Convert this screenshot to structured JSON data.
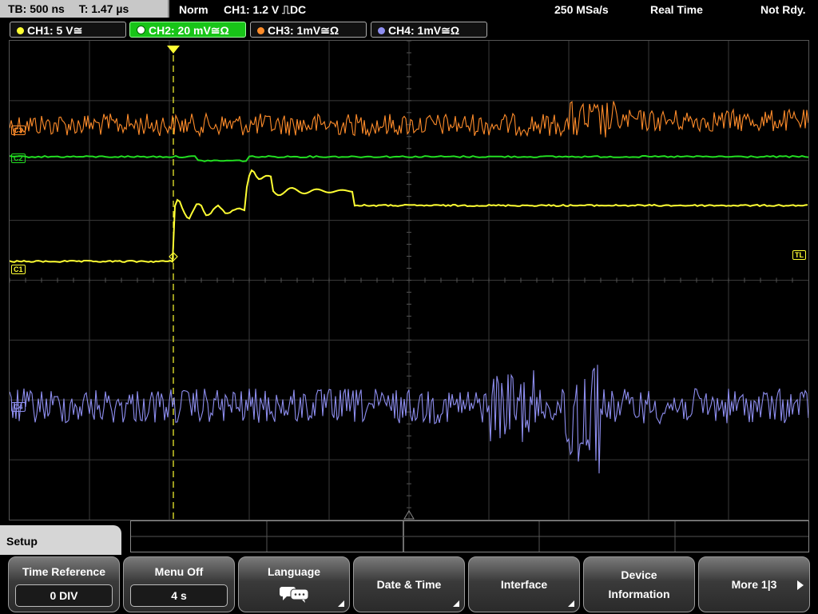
{
  "top": {
    "timebase": "TB: 500 ns",
    "trigger_time": "T: 1.47 µs",
    "mode": "Norm",
    "trigger_info": "CH1: 1.2 V ⎍DC",
    "sample_rate": "250 MSa/s",
    "acq_mode": "Real Time",
    "status": "Not Rdy."
  },
  "channels": [
    {
      "label": "CH1: 5 V≅",
      "color": "#ffff33"
    },
    {
      "label": "CH2: 20 mV≅Ω",
      "color": "#22dd22"
    },
    {
      "label": "CH3: 1mV≅Ω",
      "color": "#ff8c2a"
    },
    {
      "label": "CH4: 1mV≅Ω",
      "color": "#8e8ef0"
    }
  ],
  "markers": {
    "c3": "C3",
    "c2": "C2",
    "c1": "C1",
    "c4": "C4",
    "trigger_level": "TL",
    "trigger_pos": "T"
  },
  "menu": {
    "title": "Setup",
    "softkeys": [
      {
        "label": "Time Reference",
        "value": "0 DIV"
      },
      {
        "label": "Menu Off",
        "value": "4 s"
      },
      {
        "label": "Language",
        "icon": "speech-bubbles-icon"
      },
      {
        "label": "Date & Time"
      },
      {
        "label": "Interface"
      },
      {
        "label": "Device Information"
      },
      {
        "label": "More 1|3"
      }
    ]
  }
}
